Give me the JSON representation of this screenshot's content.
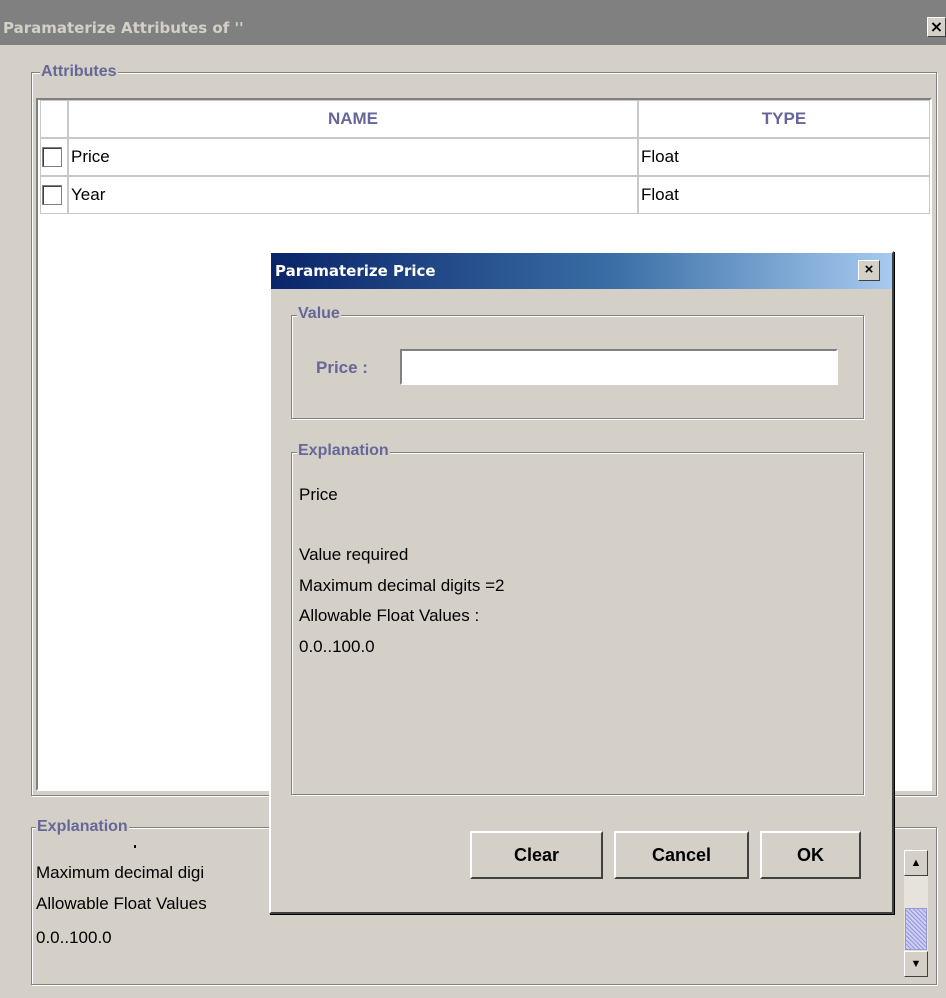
{
  "outer_window": {
    "title": "Paramaterize Attributes of ''",
    "close_glyph": "×"
  },
  "attributes": {
    "legend": "Attributes",
    "columns": [
      "NAME",
      "TYPE"
    ],
    "rows": [
      {
        "name": "Price",
        "type": "Float"
      },
      {
        "name": "Year",
        "type": "Float"
      }
    ]
  },
  "outer_explanation": {
    "legend": "Explanation",
    "lines": [
      "Maximum decimal digi",
      "Allowable Float Values",
      "0.0..100.0"
    ]
  },
  "dialog": {
    "title": "Paramaterize Price",
    "close_glyph": "×",
    "value_legend": "Value",
    "price_label": "Price :",
    "price_value": "",
    "explanation_legend": "Explanation",
    "explanation_lines": [
      "Price",
      "",
      "Value required",
      "Maximum decimal digits =2",
      "Allowable Float Values :",
      "0.0..100.0"
    ],
    "buttons": {
      "clear": "Clear",
      "cancel": "Cancel",
      "ok": "OK"
    }
  },
  "icons": {
    "scroll_up": "up-arrow-icon",
    "scroll_down": "down-arrow-icon"
  },
  "colors": {
    "title_gradient_start": "#0a246a",
    "title_gradient_end": "#a6caf0",
    "label_purple": "#666699",
    "window_bg": "#d4d0c8"
  }
}
